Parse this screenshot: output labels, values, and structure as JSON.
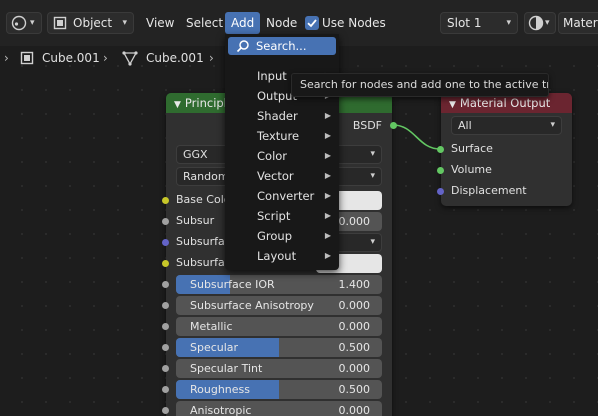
{
  "header": {
    "editor_type_icon": "node-editor-icon",
    "object_mode": "Object",
    "menus": [
      "View",
      "Select",
      "Add",
      "Node"
    ],
    "use_nodes_label": "Use Nodes",
    "use_nodes_checked": true,
    "slot": "Slot 1",
    "material_partial": "Materia"
  },
  "breadcrumb": {
    "object": "Cube.001",
    "mesh": "Cube.001"
  },
  "principled_node": {
    "title_partial": "Principle",
    "output_label": "BSDF",
    "distribution": "GGX",
    "subsurface_method_partial": "Random",
    "rows": [
      {
        "label": "Base Colo",
        "kind": "color"
      },
      {
        "label": "Subsur",
        "value": "0.000",
        "kind": "value"
      },
      {
        "label": "Subsurfa",
        "kind": "select"
      },
      {
        "label": "Subsurface",
        "kind": "color"
      },
      {
        "label": "Subsurface IOR",
        "value": "1.400",
        "kind": "slider",
        "fill": 0.26
      },
      {
        "label": "Subsurface Anisotropy",
        "value": "0.000",
        "kind": "slider",
        "fill": 0
      },
      {
        "label": "Metallic",
        "value": "0.000",
        "kind": "slider",
        "fill": 0
      },
      {
        "label": "Specular",
        "value": "0.500",
        "kind": "slider",
        "fill": 0.5
      },
      {
        "label": "Specular Tint",
        "value": "0.000",
        "kind": "slider",
        "fill": 0
      },
      {
        "label": "Roughness",
        "value": "0.500",
        "kind": "slider",
        "fill": 0.5
      },
      {
        "label": "Anisotropic",
        "value": "0.000",
        "kind": "slider",
        "fill": 0
      }
    ]
  },
  "material_output": {
    "title": "Material Output",
    "target": "All",
    "inputs": [
      "Surface",
      "Volume",
      "Displacement"
    ]
  },
  "add_menu": {
    "search_label": "Search...",
    "items": [
      "Input",
      "Output",
      "Shader",
      "Texture",
      "Color",
      "Vector",
      "Converter",
      "Script",
      "Group",
      "Layout"
    ]
  },
  "tooltip": "Search for nodes and add one to the active tree.",
  "colors": {
    "accent": "#4772b3",
    "shader_header": "#2f6b2f",
    "output_header": "#6b2530",
    "socket_green": "#63c763",
    "socket_yellow": "#c7c729",
    "socket_grey": "#a1a1a1",
    "socket_violet": "#6363c7"
  }
}
